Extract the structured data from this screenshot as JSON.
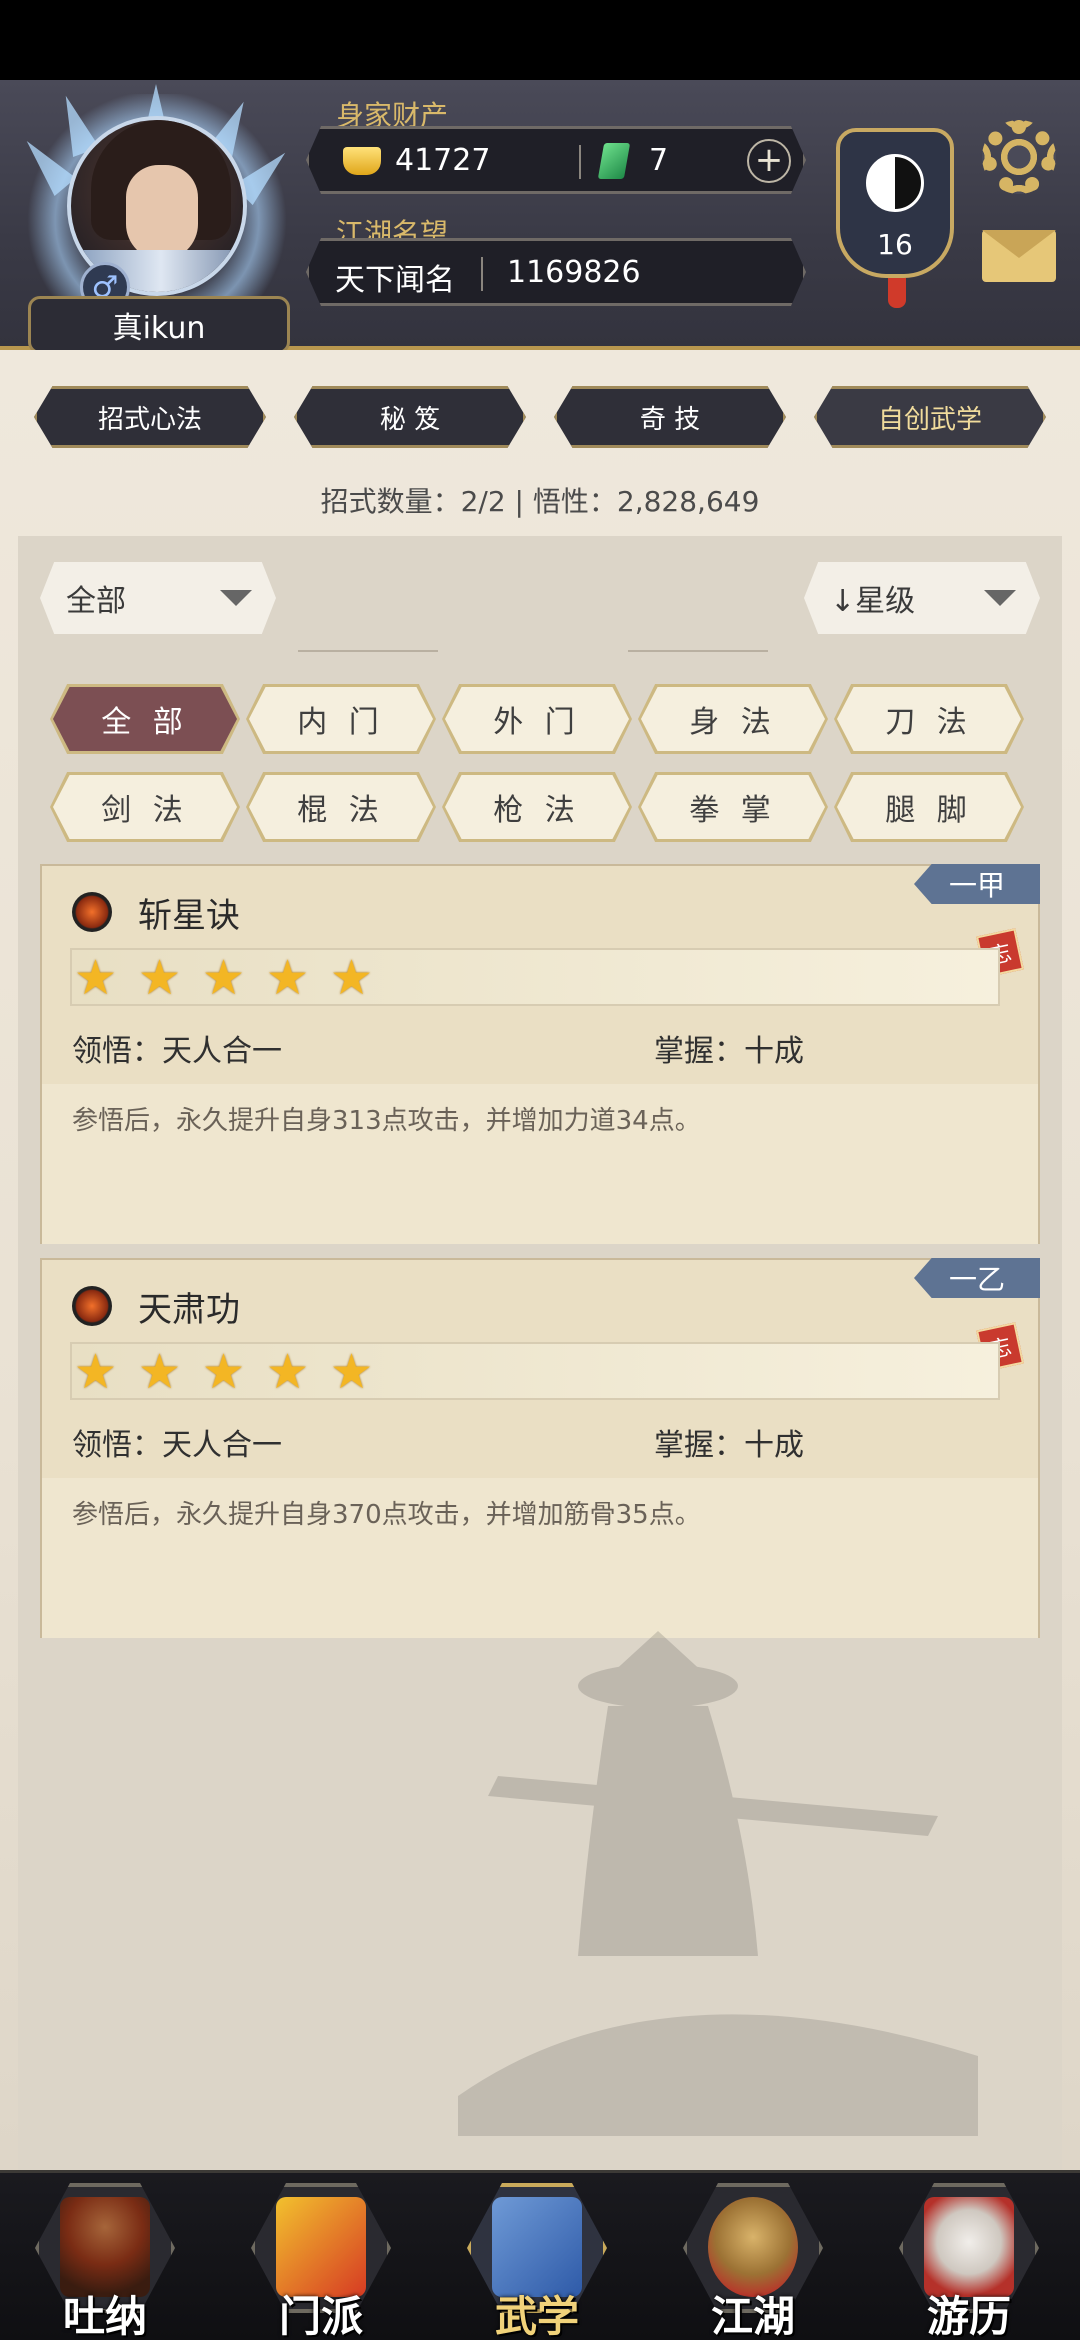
{
  "header": {
    "wealth_label": "身家财产",
    "gold": "41727",
    "jade": "7",
    "plus_icon": "+",
    "reputation_label": "江湖名望",
    "reputation_title": "天下闻名",
    "reputation_value": "1169826",
    "player_name": "真ikun",
    "gender_icon": "♂",
    "rank_level": "16"
  },
  "tabs": [
    "招式心法",
    "秘 笈",
    "奇 技",
    "自创武学"
  ],
  "summary": "招式数量：2/2 | 悟性：2,828,649",
  "filters": {
    "category_dropdown": "全部",
    "sort_dropdown": "↓星级"
  },
  "chips": [
    "全 部",
    "内 门",
    "外 门",
    "身 法",
    "刀 法",
    "剑 法",
    "棍 法",
    "枪 法",
    "拳 掌",
    "腿 脚"
  ],
  "skills": [
    {
      "name": "斩星诀",
      "grade": "一甲",
      "forget_label": "忘",
      "stars": 5,
      "comprehension": "领悟：天人合一",
      "mastery": "掌握：十成",
      "description": "参悟后，永久提升自身313点攻击，并增加力道34点。"
    },
    {
      "name": "天肃功",
      "grade": "一乙",
      "forget_label": "忘",
      "stars": 5,
      "comprehension": "领悟：天人合一",
      "mastery": "掌握：十成",
      "description": "参悟后，永久提升自身370点攻击，并增加筋骨35点。"
    }
  ],
  "bottom_nav": [
    "吐纳",
    "门派",
    "武学",
    "江湖",
    "游历"
  ],
  "colors": {
    "accent_gold": "#d9b96a",
    "active_chip": "#7c4f53",
    "grade_tag": "#5e7393",
    "star": "#f3b624"
  },
  "icons": [
    "gear-icon",
    "mail-icon",
    "yin-yang-icon",
    "gold-ingot-icon",
    "jade-icon",
    "skill-icon",
    "star-icon",
    "caret-down-icon"
  ]
}
